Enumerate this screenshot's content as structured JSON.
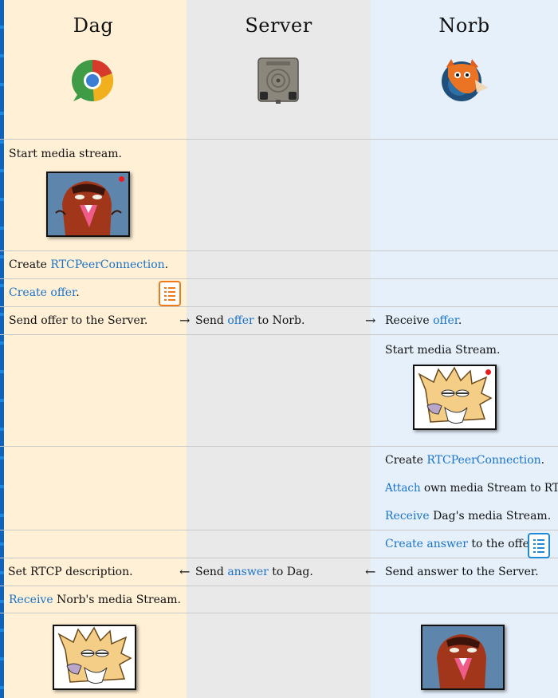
{
  "columns": {
    "dag": "Dag",
    "server": "Server",
    "norb": "Norb"
  },
  "icons": {
    "dag_avatar": "chrome-browser-icon",
    "server_avatar": "server-box-icon",
    "norb_avatar": "firefox-browser-icon",
    "media_dag": "beaver-dag-media-icon",
    "media_norb": "beaver-norb-media-icon",
    "document": "document-icon"
  },
  "colors": {
    "dag_column": "#fff0d6",
    "server_column": "#e9e9e9",
    "norb_column": "#e5f0fb",
    "link": "#1a73c8",
    "doc_orange": "#ef7a1a",
    "doc_blue": "#1e8ad6",
    "record_dot": "#e81e1e"
  },
  "steps": {
    "dag_start": "Start media stream.",
    "dag_create_a": "Create ",
    "dag_create_link": "RTCPeerConnection",
    "dag_create_b": ".",
    "dag_offer_link": "Create offer",
    "dag_offer_b": ".",
    "dag_send": "Send offer to the Server.",
    "server_send_a": "Send ",
    "server_send_link": "offer",
    "server_send_b": " to Norb.",
    "norb_receive_a": "Receive ",
    "norb_receive_link": "offer",
    "norb_receive_b": ".",
    "norb_start": "Start media Stream.",
    "norb_create_a": "Create ",
    "norb_create_link": "RTCPeerConnection",
    "norb_create_b": ".",
    "norb_attach_link": "Attach",
    "norb_attach_b": " own media Stream to RTCP.",
    "norb_recv_link": "Receive",
    "norb_recv_b": " Dag's media Stream.",
    "norb_answer_link": "Create answer",
    "norb_answer_b": " to the offer.",
    "dag_set": "Set RTCP description.",
    "server_ans_a": "Send ",
    "server_ans_link": "answer",
    "server_ans_b": " to Dag.",
    "norb_send": "Send answer to the Server.",
    "dag_recv_link": "Receive",
    "dag_recv_b": " Norb's media Stream."
  },
  "arrows": {
    "right_1": "→",
    "right_2": "→",
    "left_1": "←",
    "left_2": "←"
  }
}
